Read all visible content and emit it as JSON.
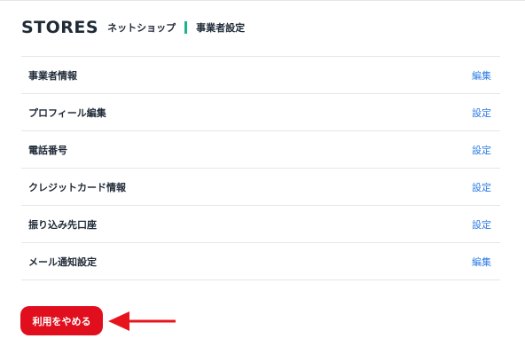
{
  "header": {
    "logo": "STORES",
    "shop_label": "ネットショップ",
    "admin_label": "事業者設定",
    "accent_color": "#18b58c"
  },
  "settings": [
    {
      "label": "事業者情報",
      "action": "編集"
    },
    {
      "label": "プロフィール編集",
      "action": "設定"
    },
    {
      "label": "電話番号",
      "action": "設定"
    },
    {
      "label": "クレジットカード情報",
      "action": "設定"
    },
    {
      "label": "振り込み先口座",
      "action": "設定"
    },
    {
      "label": "メール通知設定",
      "action": "編集"
    }
  ],
  "cancel_button": {
    "label": "利用をやめる",
    "color": "#e10e1e"
  },
  "annotation": {
    "icon": "red-arrow-left-icon",
    "color": "#e8141c"
  }
}
